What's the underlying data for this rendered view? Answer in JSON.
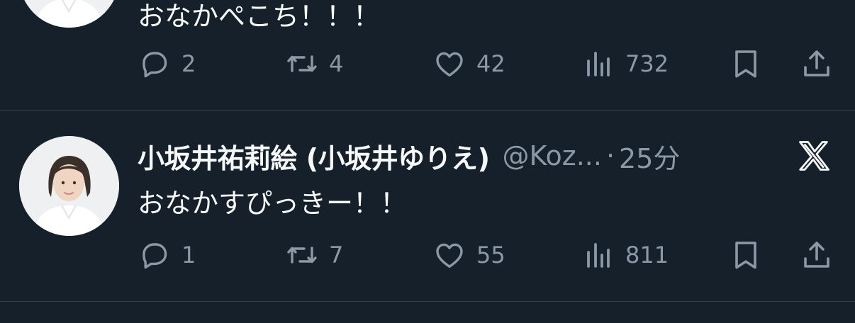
{
  "tweets": [
    {
      "text": "おなかぺこち！！！",
      "actions": {
        "replies": "2",
        "retweets": "4",
        "likes": "42",
        "views": "732"
      }
    },
    {
      "display_name": "小坂井祐莉絵 (小坂井ゆりえ)",
      "handle": "@Koz...",
      "separator": "·",
      "time": "25分",
      "text": "おなかすぴっきー！！",
      "actions": {
        "replies": "1",
        "retweets": "7",
        "likes": "55",
        "views": "811"
      }
    }
  ],
  "icons": {
    "reply": "speech-bubble-icon",
    "retweet": "retweet-arrows-icon",
    "like": "heart-icon",
    "views": "bar-chart-icon",
    "bookmark": "bookmark-icon",
    "share": "share-upload-icon",
    "source": "x-logo-icon"
  },
  "colors": {
    "background": "#15202b",
    "text_primary": "#f7f9f9",
    "text_secondary": "#8b98a5",
    "divider": "#38444d"
  }
}
